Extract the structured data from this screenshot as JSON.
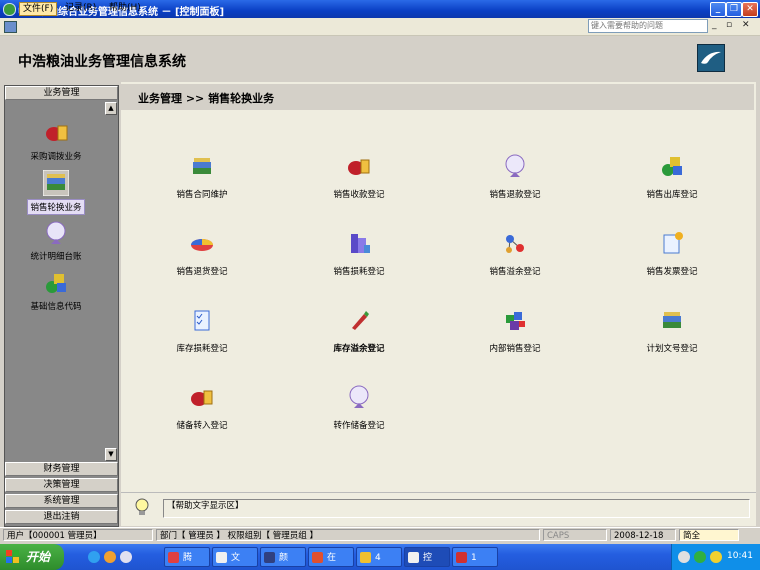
{
  "window": {
    "title": "中浩粮油综合业务管理信息系统 － [控制面板]"
  },
  "menubar": {
    "items": [
      {
        "label": "文件(F)"
      },
      {
        "label": "记录(R)"
      },
      {
        "label": "帮助(H)"
      }
    ],
    "help_placeholder": "键入需要帮助的问题"
  },
  "header": {
    "title": "中浩粮油业务管理信息系统"
  },
  "sidebar": {
    "header": "业务管理",
    "items": [
      {
        "label": "采购调拨业务",
        "icon": "purchase-icon"
      },
      {
        "label": "销售轮换业务",
        "icon": "sales-rotation-icon",
        "selected": true
      },
      {
        "label": "统计明细台账",
        "icon": "statistics-icon"
      },
      {
        "label": "基础信息代码",
        "icon": "basic-info-icon"
      }
    ],
    "sections": [
      {
        "label": "财务管理"
      },
      {
        "label": "决策管理"
      },
      {
        "label": "系统管理"
      },
      {
        "label": "退出注销"
      }
    ]
  },
  "breadcrumb": {
    "text": "业务管理 >> 销售轮换业务"
  },
  "tiles": [
    {
      "label": "销售合同维护",
      "icon": "books-icon"
    },
    {
      "label": "销售收款登记",
      "icon": "money-bag-icon"
    },
    {
      "label": "销售退款登记",
      "icon": "globe-icon"
    },
    {
      "label": "销售出库登记",
      "icon": "shapes-icon"
    },
    {
      "label": "销售退货登记",
      "icon": "pie-chart-icon"
    },
    {
      "label": "销售损耗登记",
      "icon": "buildings-icon"
    },
    {
      "label": "销售溢余登记",
      "icon": "molecule-icon"
    },
    {
      "label": "销售发票登记",
      "icon": "invoice-icon"
    },
    {
      "label": "库存损耗登记",
      "icon": "checklist-icon"
    },
    {
      "label": "库存溢余登记",
      "icon": "pen-icon",
      "bold": true
    },
    {
      "label": "内部销售登记",
      "icon": "cubes-icon"
    },
    {
      "label": "计划文号登记",
      "icon": "books-icon"
    },
    {
      "label": "储备转入登记",
      "icon": "money-bag-icon"
    },
    {
      "label": "转作储备登记",
      "icon": "globe-icon"
    }
  ],
  "help": {
    "text": "【帮助文字显示区】"
  },
  "status": {
    "user": "用户【000001 管理员】",
    "dept": "部门【 管理员 】 权限组别【 管理员组 】",
    "caps": "CAPS",
    "date": "2008-12-18",
    "ime": "简全"
  },
  "taskbar": {
    "start_label": "开始",
    "buttons": [
      {
        "label": "腾"
      },
      {
        "label": "文"
      },
      {
        "label": "颜"
      },
      {
        "label": "在"
      },
      {
        "label": "4"
      },
      {
        "label": "控"
      },
      {
        "label": "1"
      }
    ],
    "clock": "10:41"
  }
}
